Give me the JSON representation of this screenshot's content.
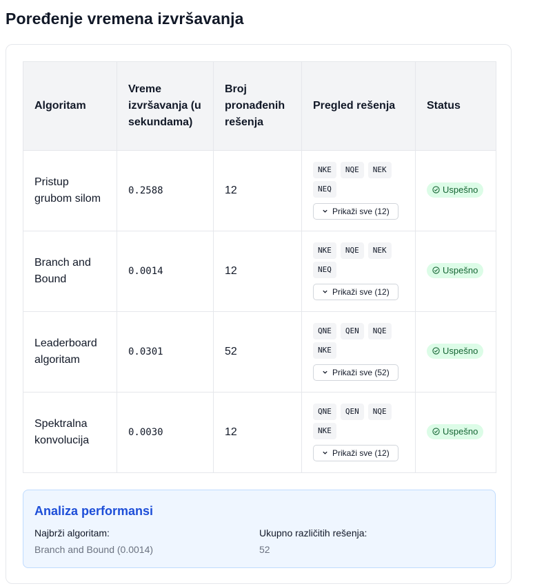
{
  "title": "Poređenje vremena izvršavanja",
  "table": {
    "headers": [
      "Algoritam",
      "Vreme izvršavanja (u sekundama)",
      "Broj pronađenih rešenja",
      "Pregled rešenja",
      "Status"
    ],
    "rows": [
      {
        "algorithm": "Pristup grubom silom",
        "time": "0.2588",
        "count": "12",
        "chips": [
          "NKE",
          "NQE",
          "NEK",
          "NEQ"
        ],
        "show_all": "Prikaži sve (12)",
        "status": "Uspešno"
      },
      {
        "algorithm": "Branch and Bound",
        "time": "0.0014",
        "count": "12",
        "chips": [
          "NKE",
          "NQE",
          "NEK",
          "NEQ"
        ],
        "show_all": "Prikaži sve (12)",
        "status": "Uspešno"
      },
      {
        "algorithm": "Leaderboard algoritam",
        "time": "0.0301",
        "count": "52",
        "chips": [
          "QNE",
          "QEN",
          "NQE",
          "NKE"
        ],
        "show_all": "Prikaži sve (52)",
        "status": "Uspešno"
      },
      {
        "algorithm": "Spektralna konvolucija",
        "time": "0.0030",
        "count": "12",
        "chips": [
          "QNE",
          "QEN",
          "NQE",
          "NKE"
        ],
        "show_all": "Prikaži sve (12)",
        "status": "Uspešno"
      }
    ]
  },
  "analysis": {
    "title": "Analiza performansi",
    "fastest_label": "Najbrži algoritam:",
    "fastest_value": "Branch and Bound (0.0014)",
    "total_label": "Ukupno različitih rešenja:",
    "total_value": "52"
  },
  "icons": {
    "chevron": "chevron-down-icon",
    "status": "check-circle-icon"
  },
  "colors": {
    "accent": "#1d4ed8",
    "success_bg": "#dcfce7",
    "success_text": "#166534",
    "header_bg": "#f3f4f6"
  }
}
